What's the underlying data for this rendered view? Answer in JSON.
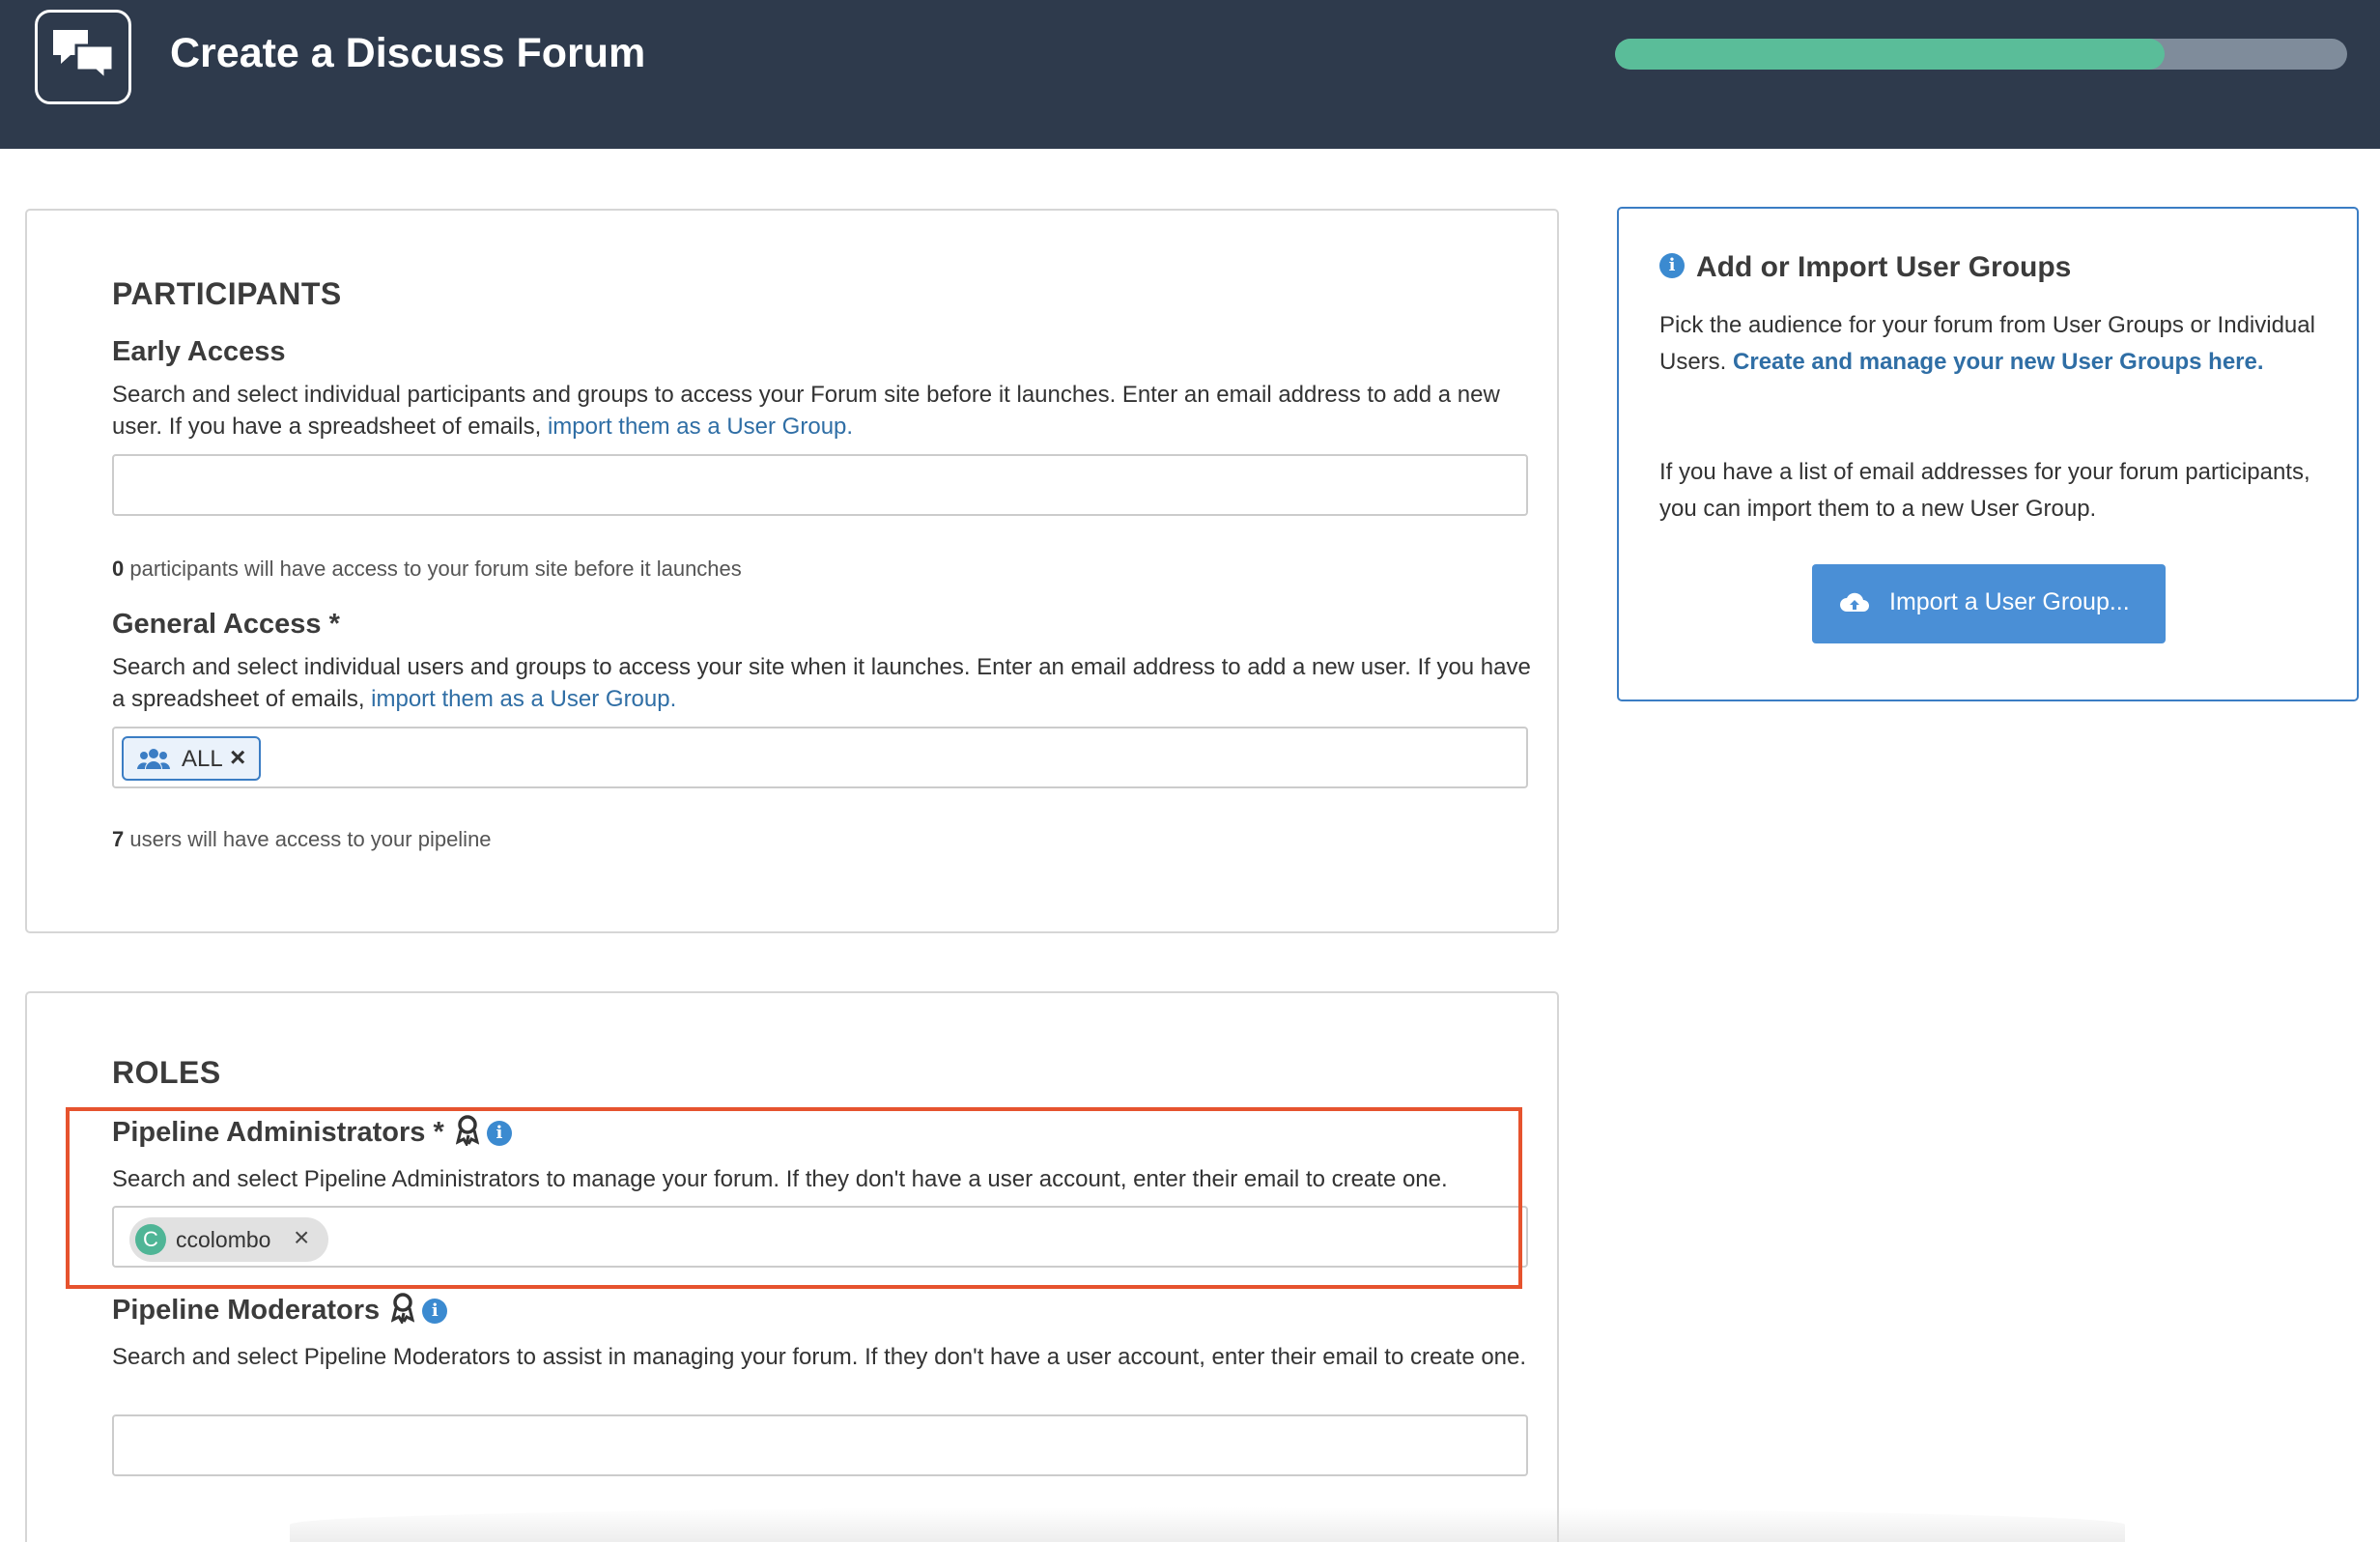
{
  "header": {
    "title": "Create a Discuss Forum",
    "progress_fraction": 0.75,
    "colors": {
      "background": "#2e3a4c",
      "progress_fill": "#5abd99",
      "progress_track": "#7f8c9b"
    },
    "logo_icon": "chat-bubbles-icon"
  },
  "participants": {
    "section_title": "PARTICIPANTS",
    "early_access": {
      "title": "Early Access",
      "desc_text": "Search and select individual participants and groups to access your Forum site before it launches. Enter an email address to add a new user. If you have a spreadsheet of emails, ",
      "desc_link": "import them as a User Group.",
      "count": "0",
      "count_text": " participants will have access to your forum site before it launches"
    },
    "general_access": {
      "title": "General Access *",
      "desc_text": "Search and select individual users and groups to access your site when it launches. Enter an email address to add a new user. If you have a spreadsheet of emails, ",
      "desc_link": "import them as a User Group.",
      "tag_label": "ALL",
      "tag_icon": "users-icon",
      "count": "7",
      "count_text": " users will have access to your pipeline"
    }
  },
  "roles": {
    "section_title": "ROLES",
    "admins": {
      "title": "Pipeline Administrators *",
      "desc": "Search and select Pipeline Administrators to manage your forum. If they don't have a user account, enter their email to create one.",
      "user_initial": "C",
      "user_name": "ccolombo"
    },
    "moderators": {
      "title": "Pipeline Moderators",
      "desc": "Search and select Pipeline Moderators to assist in managing your forum. If they don't have a user account, enter their email to create one."
    }
  },
  "side_panel": {
    "title": "Add or Import User Groups",
    "para1_text": "Pick the audience for your forum from User Groups or Individual Users. ",
    "para1_link": "Create and manage your new User Groups here.",
    "para2": "If you have a list of email addresses for your forum participants, you can import them to a new User Group.",
    "import_button": "Import a User Group...",
    "import_icon": "cloud-upload-icon"
  },
  "info_symbol": "i",
  "remove_symbol": "×"
}
